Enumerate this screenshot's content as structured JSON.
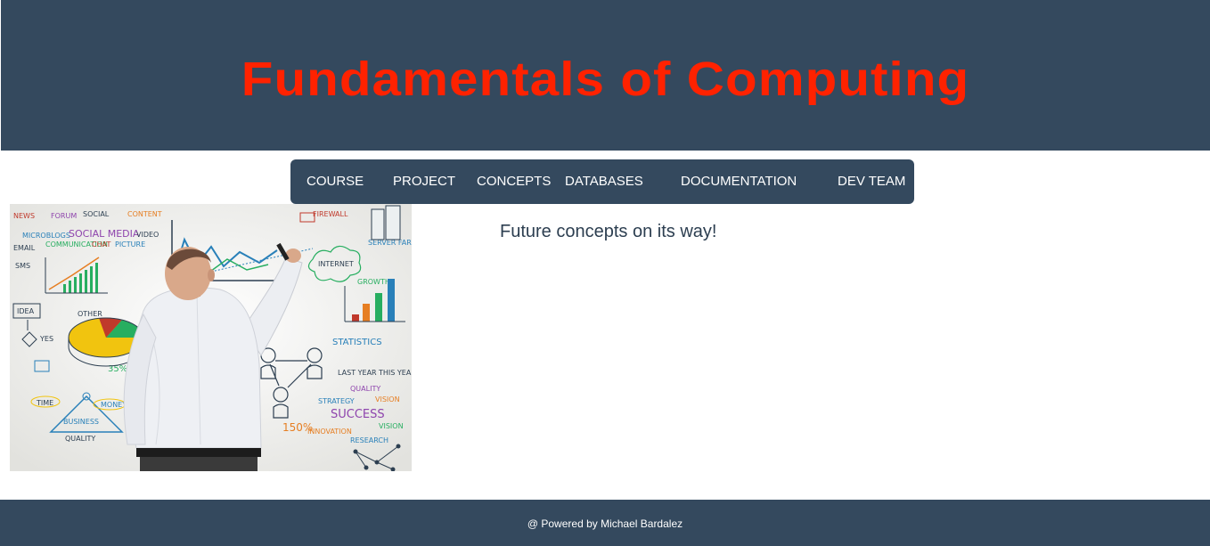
{
  "header": {
    "title": "Fundamentals of Computing",
    "title_color": "#ff2200",
    "background": "#34495e"
  },
  "nav": {
    "items": [
      {
        "label": "COURSE"
      },
      {
        "label": "PROJECT"
      },
      {
        "label": "CONCEPTS"
      },
      {
        "label": "DATABASES"
      },
      {
        "label": "DOCUMENTATION"
      },
      {
        "label": "DEV TEAM"
      }
    ]
  },
  "hero": {
    "image": "man-drawing-concept-sketches-on-whiteboard",
    "whiteboard_words": [
      "NEWS",
      "FORUM",
      "SOCIAL NETWORK",
      "CONTENT SHARING",
      "MICROBLOGS",
      "SOCIAL MEDIA",
      "VIDEO",
      "COMMUNICATION",
      "CHAT",
      "PICTURE",
      "EMAIL",
      "SMS",
      "IDEA",
      "YES",
      "INTERNET",
      "SERVER FARM",
      "FIREWALL",
      "GROWTH",
      "STATISTICS",
      "LAST YEAR",
      "THIS YEAR",
      "QUALITY",
      "STRATEGY",
      "VISION",
      "SUCCESS",
      "INNOVATION",
      "RESEARCH",
      "TIME",
      "MONEY",
      "BUSINESS",
      "150%",
      "35%"
    ]
  },
  "main": {
    "text": "Future concepts on its way!"
  },
  "footer": {
    "text": "@ Powered by Michael Bardalez"
  }
}
